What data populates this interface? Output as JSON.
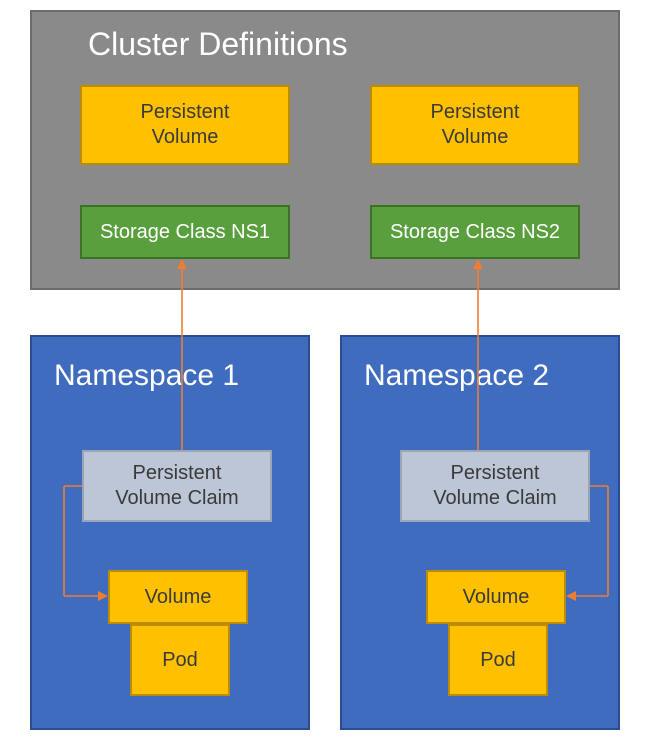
{
  "colors": {
    "cluster_bg": "#8a8a8a",
    "namespace_bg": "#3f6cbf",
    "pv_bg": "#ffc000",
    "sc_bg": "#5a9f3d",
    "pvc_bg": "#bcc6d6",
    "arrow": "#ed7d31"
  },
  "cluster": {
    "title": "Cluster Definitions",
    "pv1": "Persistent\nVolume",
    "pv2": "Persistent\nVolume",
    "sc1": "Storage Class NS1",
    "sc2": "Storage Class NS2"
  },
  "ns1": {
    "title": "Namespace 1",
    "pvc": "Persistent\nVolume Claim",
    "volume": "Volume",
    "pod": "Pod"
  },
  "ns2": {
    "title": "Namespace 2",
    "pvc": "Persistent\nVolume Claim",
    "volume": "Volume",
    "pod": "Pod"
  }
}
